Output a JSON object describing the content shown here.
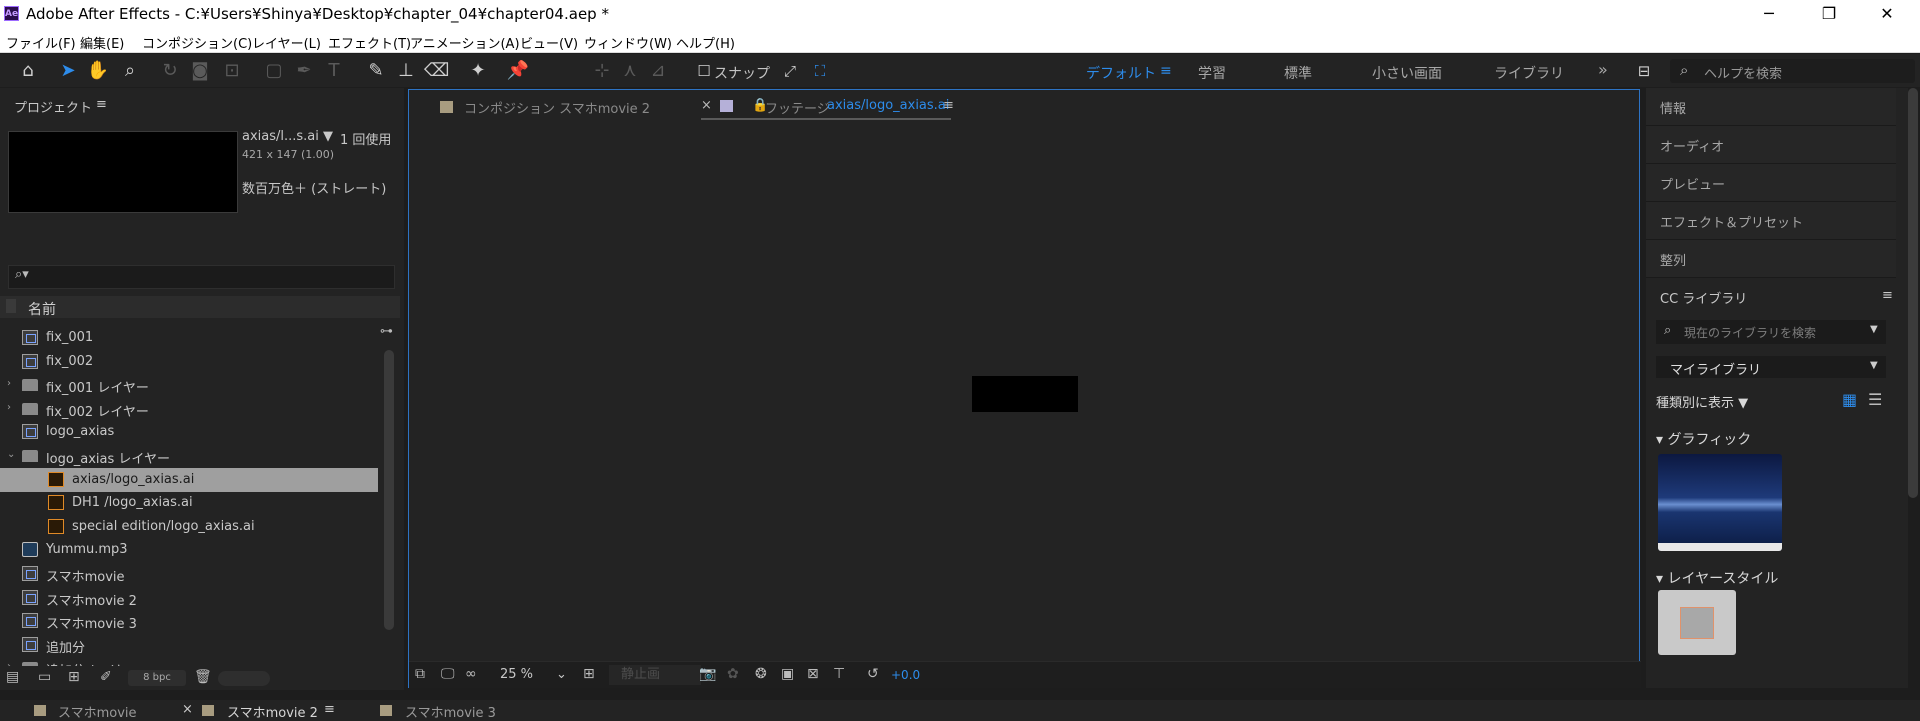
{
  "window": {
    "logo": "Ae",
    "title": "Adobe After Effects - C:¥Users¥Shinya¥Desktop¥chapter_04¥chapter04.aep *",
    "controls": [
      "─",
      "❐",
      "✕"
    ]
  },
  "menu": [
    "ファイル(F)",
    "編集(E)",
    "コンポジション(C)",
    "レイヤー(L)",
    "エフェクト(T)",
    "アニメーション(A)",
    "ビュー(V)",
    "ウィンドウ(W)",
    "ヘルプ(H)"
  ],
  "toolbar": {
    "snap_label": "スナップ",
    "workspaces": [
      "デフォルト",
      "学習",
      "標準",
      "小さい画面",
      "ライブラリ"
    ],
    "workspace_more": "»",
    "help_placeholder": "ヘルプを検索"
  },
  "project": {
    "title": "プロジェクト",
    "selected_name": "axias/l...s.ai ▼",
    "usage": "1 回使用",
    "dimensions": "421 x 147 (1.00)",
    "color_info": "数百万色＋ (ストレート)",
    "column_name": "名前",
    "items": [
      {
        "label": "fix_001",
        "icon": "composition-icon",
        "indent": 0,
        "twist": ""
      },
      {
        "label": "fix_002",
        "icon": "composition-icon",
        "indent": 0,
        "twist": ""
      },
      {
        "label": "fix_001 レイヤー",
        "icon": "folder-icon",
        "indent": 0,
        "twist": "›"
      },
      {
        "label": "fix_002 レイヤー",
        "icon": "folder-icon",
        "indent": 0,
        "twist": "›"
      },
      {
        "label": "logo_axias",
        "icon": "composition-icon",
        "indent": 0,
        "twist": ""
      },
      {
        "label": "logo_axias レイヤー",
        "icon": "folder-icon",
        "indent": 0,
        "twist": "⌄"
      },
      {
        "label": "axias/logo_axias.ai",
        "icon": "ai-file-icon",
        "indent": 1,
        "twist": "",
        "selected": true
      },
      {
        "label": "DH1 /logo_axias.ai",
        "icon": "ai-file-icon",
        "indent": 1,
        "twist": ""
      },
      {
        "label": "special edition/logo_axias.ai",
        "icon": "ai-file-icon",
        "indent": 1,
        "twist": ""
      },
      {
        "label": "Yummu.mp3",
        "icon": "audio-file-icon",
        "indent": 0,
        "twist": ""
      },
      {
        "label": "スマホmovie",
        "icon": "composition-icon",
        "indent": 0,
        "twist": ""
      },
      {
        "label": "スマホmovie 2",
        "icon": "composition-icon",
        "indent": 0,
        "twist": ""
      },
      {
        "label": "スマホmovie 3",
        "icon": "composition-icon",
        "indent": 0,
        "twist": ""
      },
      {
        "label": "追加分",
        "icon": "composition-icon",
        "indent": 0,
        "twist": ""
      },
      {
        "label": "追加分 レイヤー",
        "icon": "folder-icon",
        "indent": 0,
        "twist": "›"
      }
    ],
    "bpc": "8 bpc"
  },
  "viewer": {
    "tab_comp": "コンポジション スマホmovie 2",
    "tab_footage_prefix": "フッテージ",
    "tab_footage_name": "axias/logo_axias.ai",
    "zoom": "25 %",
    "still_label": "静止画",
    "exposure": "+0.0",
    "colors": {
      "accent": "#2d8ceb",
      "comp_swatch": "#a89c80",
      "footage_swatch": "#b5b0d8"
    }
  },
  "right_panel": {
    "items": [
      "情報",
      "オーディオ",
      "プレビュー",
      "エフェクト＆プリセット",
      "整列"
    ],
    "cc_title": "CC ライブラリ",
    "cc_search_placeholder": "現在のライブラリを検索",
    "library_name": "マイライブラリ",
    "view_by": "種類別に表示",
    "section_graphics": "グラフィック",
    "section_layer_styles": "レイヤースタイル"
  },
  "bottom_tabs": [
    "スマホmovie",
    "スマホmovie 2",
    "スマホmovie 3"
  ]
}
